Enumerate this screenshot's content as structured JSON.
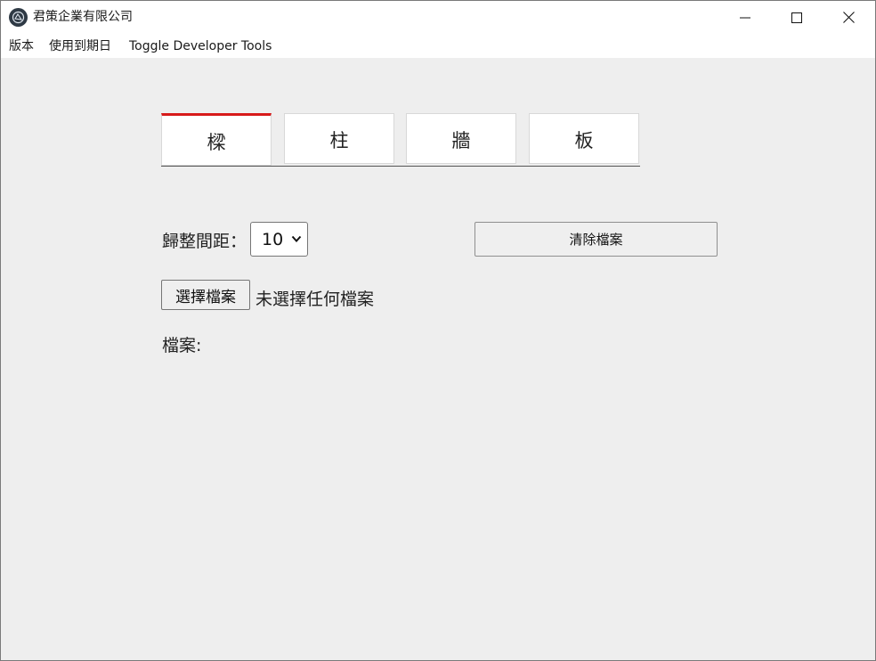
{
  "window": {
    "title": "君策企業有限公司"
  },
  "menu": {
    "items": [
      "版本",
      "使用到期日",
      "Toggle Developer Tools"
    ]
  },
  "tabs": [
    {
      "label": "樑",
      "active": true
    },
    {
      "label": "柱",
      "active": false
    },
    {
      "label": "牆",
      "active": false
    },
    {
      "label": "板",
      "active": false
    }
  ],
  "form": {
    "interval_label": "歸整間距：",
    "interval_value": "10",
    "clear_button": "清除檔案",
    "choose_file_button": "選擇檔案",
    "file_status": "未選擇任何檔案",
    "files_label": "檔案:"
  },
  "colors": {
    "accent": "#d71a1a",
    "content_bg": "#eeeeee"
  },
  "icons": {
    "app": "app-logo-icon",
    "minimize": "minimize-icon",
    "maximize": "maximize-icon",
    "close": "close-icon",
    "dropdown": "chevron-down-icon"
  }
}
